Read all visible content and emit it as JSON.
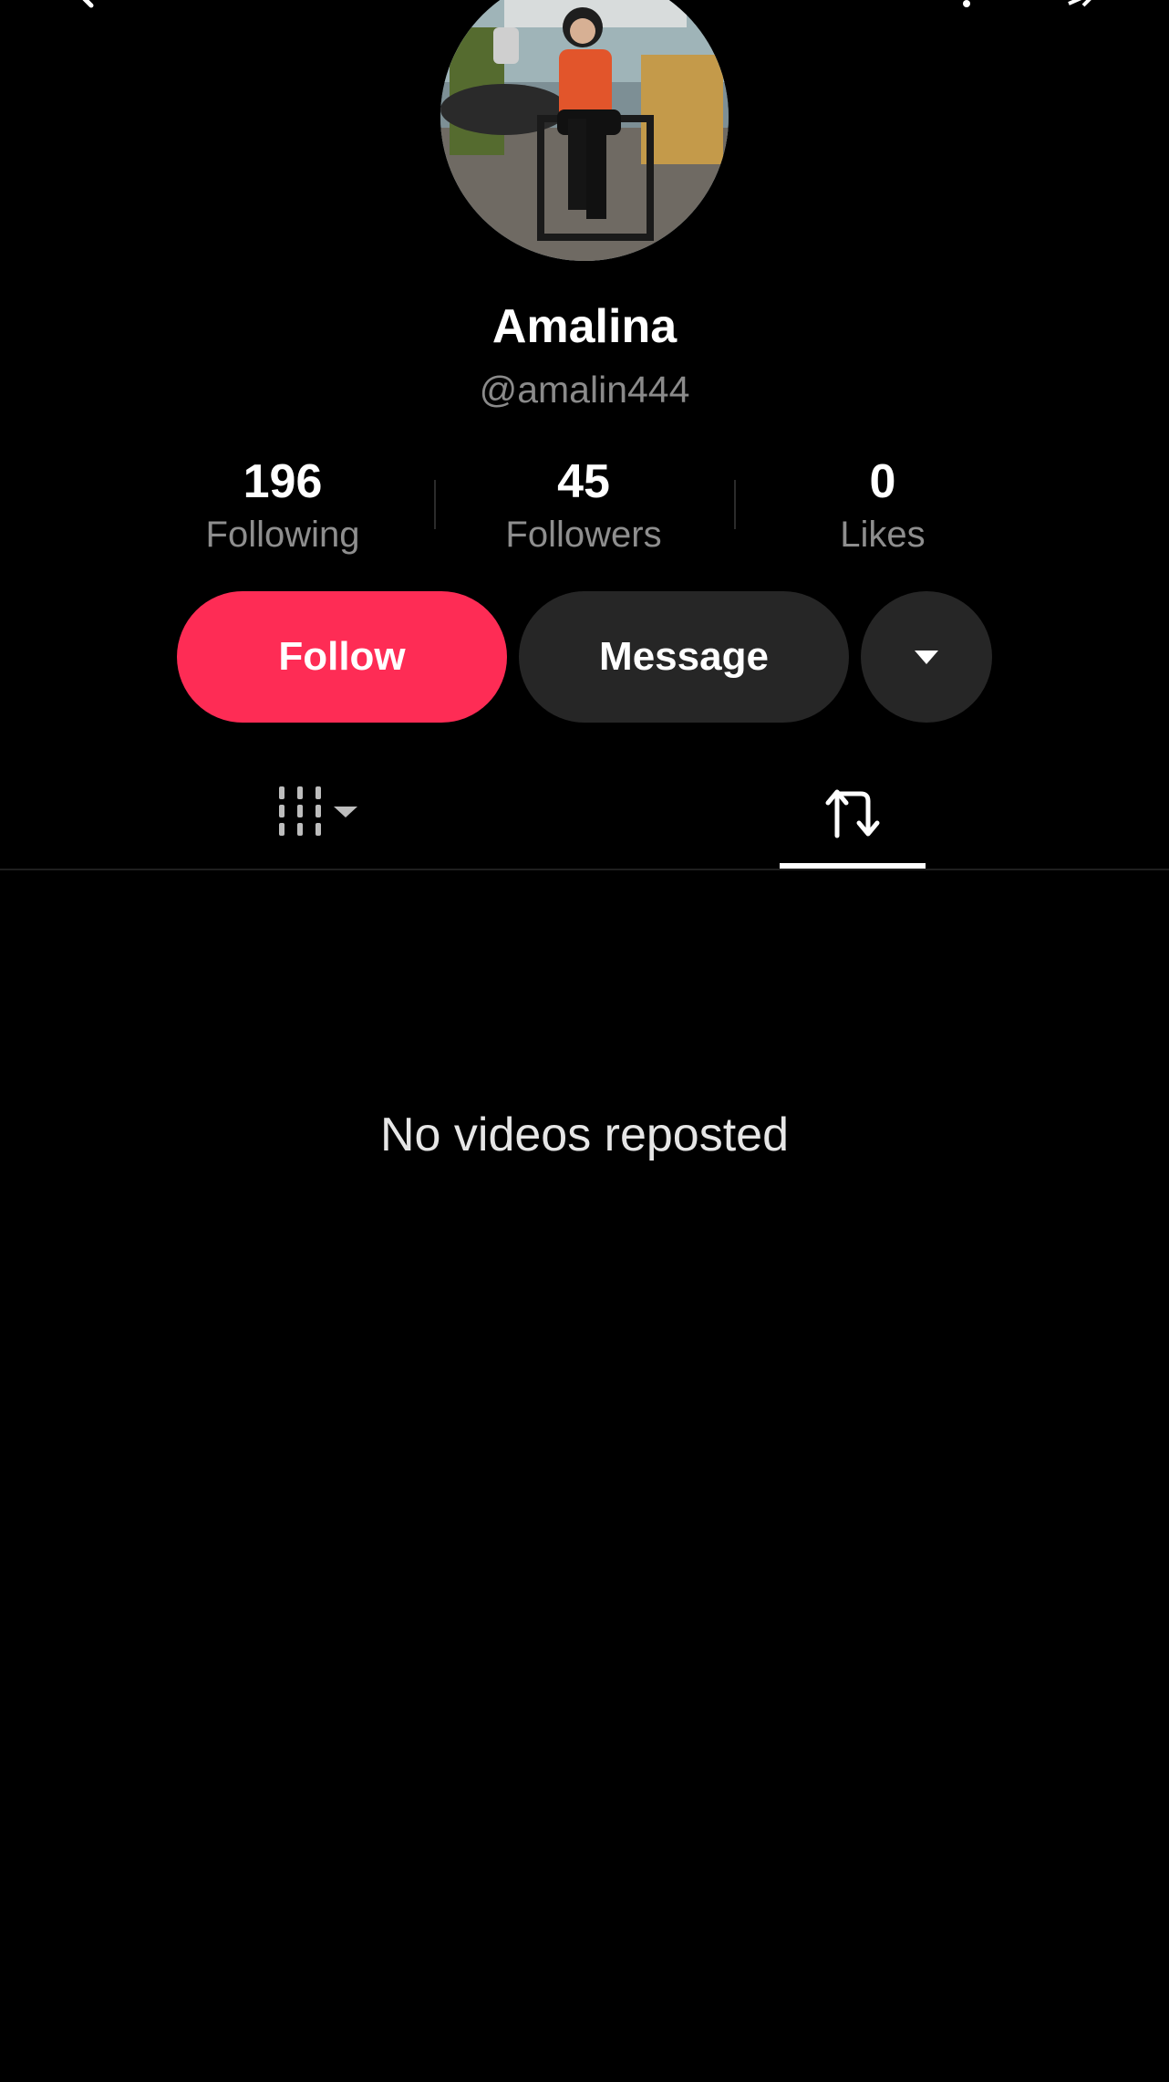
{
  "profile": {
    "name": "Amalina",
    "handle": "@amalin444"
  },
  "stats": [
    {
      "value": "196",
      "label": "Following"
    },
    {
      "value": "45",
      "label": "Followers"
    },
    {
      "value": "0",
      "label": "Likes"
    }
  ],
  "actions": {
    "follow_label": "Follow",
    "message_label": "Message",
    "more_icon": "caret-down-icon"
  },
  "tabs": [
    {
      "icon": "videos-grid-icon",
      "active": false
    },
    {
      "icon": "repost-icon",
      "active": true
    }
  ],
  "content": {
    "empty_message": "No videos reposted"
  },
  "colors": {
    "follow_accent": "#fe2c55",
    "button_dark": "#262626",
    "background": "#000000"
  }
}
